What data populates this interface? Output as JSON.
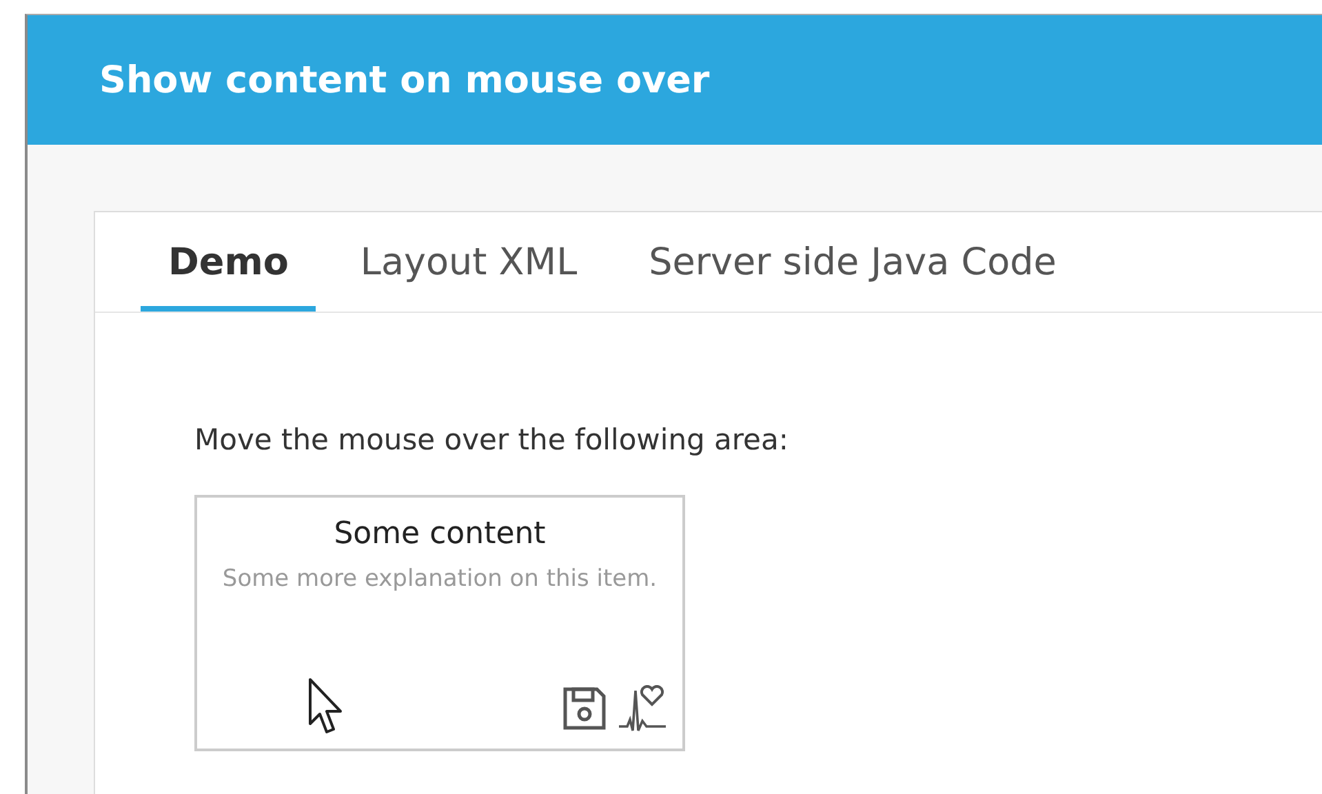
{
  "header": {
    "title": "Show content on mouse over"
  },
  "tabs": [
    {
      "label": "Demo",
      "selected": true
    },
    {
      "label": "Layout XML",
      "selected": false
    },
    {
      "label": "Server side Java Code",
      "selected": false
    }
  ],
  "instruction": "Move the mouse over the following area:",
  "hover_area": {
    "title": "Some content",
    "description": "Some more explanation on this item."
  }
}
